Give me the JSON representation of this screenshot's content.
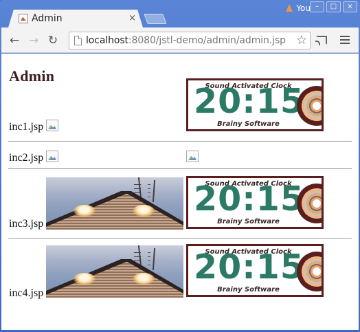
{
  "browser": {
    "tab_title": "Admin",
    "tab_close": "×",
    "user_label": "You",
    "url_host": "localhost",
    "url_rest": ":8080/jstl-demo/admin/admin.jsp",
    "window_buttons": [
      "–",
      "□",
      "×"
    ]
  },
  "page": {
    "heading": "Admin",
    "rows": [
      {
        "label": "inc1.jsp",
        "images": [
          "broken-image",
          "clock"
        ]
      },
      {
        "label": "inc2.jsp",
        "images": [
          "broken-image",
          "broken-image"
        ]
      },
      {
        "label": "inc3.jsp",
        "images": [
          "house-photo",
          "clock"
        ]
      },
      {
        "label": "inc4.jsp",
        "images": [
          "house-photo",
          "clock"
        ]
      }
    ]
  },
  "clock_image": {
    "top_text": "Sound Activated Clock",
    "time": "20:15",
    "bottom_text": "Brainy Software"
  },
  "colors": {
    "titlebar": "#4a74c9",
    "heading": "#3a1e1e",
    "clock_digits": "#2a7a66",
    "clock_border": "#5a1e1e"
  }
}
